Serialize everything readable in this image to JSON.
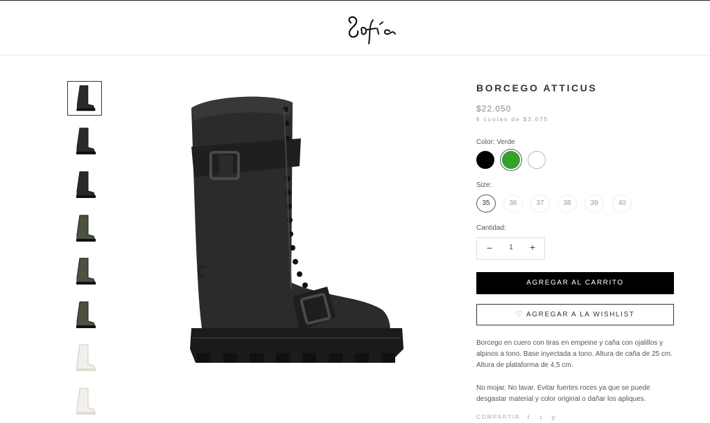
{
  "brand": {
    "logo_text": "Sofía",
    "logo_icon": "sofia-script-logo"
  },
  "gallery": {
    "thumbnails": [
      {
        "name": "thumb-1",
        "color": "#2a2a2a",
        "active": true
      },
      {
        "name": "thumb-2",
        "color": "#2a2a2a"
      },
      {
        "name": "thumb-3",
        "color": "#2a2a2a"
      },
      {
        "name": "thumb-4",
        "color": "#4b5340"
      },
      {
        "name": "thumb-5",
        "color": "#4b5340"
      },
      {
        "name": "thumb-6",
        "color": "#4b5340"
      },
      {
        "name": "thumb-7",
        "color": "#f2f0ea"
      },
      {
        "name": "thumb-8",
        "color": "#f2f0ea"
      }
    ],
    "main_image_color": "#2b2b2b"
  },
  "product": {
    "title": "BORCEGO ATTICUS",
    "price": "$22.050",
    "installments": "6 cuotas de $3.675",
    "color_label": "Color: Verde",
    "colors": [
      {
        "name": "Negro",
        "hex": "#000000"
      },
      {
        "name": "Verde",
        "hex": "#35a02c",
        "selected": true
      },
      {
        "name": "Blanco",
        "hex": "#ffffff"
      }
    ],
    "size_label": "Size:",
    "sizes": [
      "35",
      "36",
      "37",
      "38",
      "39",
      "40"
    ],
    "selected_size": "35",
    "quantity_label": "Cantidad:",
    "quantity": "1",
    "minus": "−",
    "plus": "+",
    "add_to_cart": "AGREGAR AL CARRITO",
    "add_to_wishlist": "AGREGAR A LA WISHLIST",
    "description_1": "Borcego en cuero con tiras en empeine y caña con ojalillos y alpinos a tono. Base inyectada a tono. Altura de caña de 25 cm. Altura de plataforma de 4,5 cm.",
    "description_2": "No mojar. No lavar. Evitar fuertes roces ya que se puede desgastar material y color original o dañar los apliques.",
    "share_label": "COMPARTIR",
    "share_icons": [
      {
        "name": "facebook-icon",
        "glyph": "f"
      },
      {
        "name": "twitter-icon",
        "glyph": "t"
      },
      {
        "name": "pinterest-icon",
        "glyph": "p"
      }
    ]
  }
}
